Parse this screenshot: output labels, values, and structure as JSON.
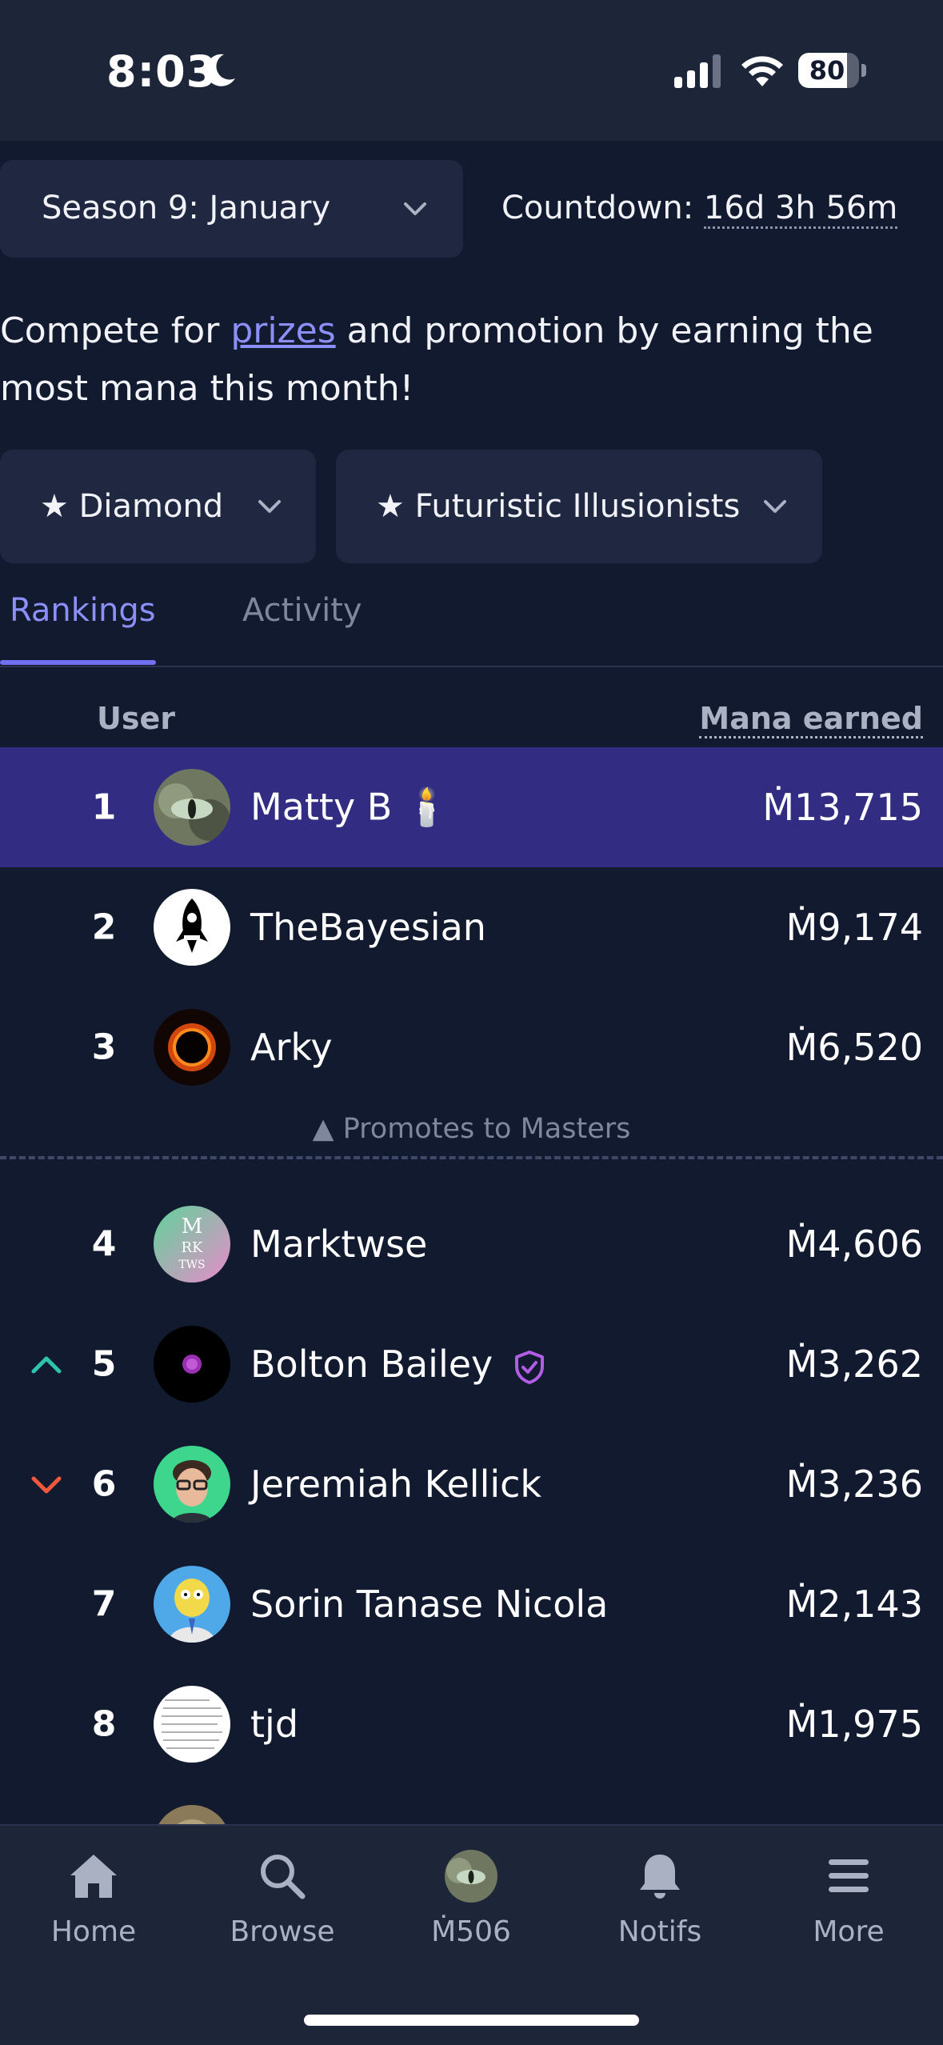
{
  "status_bar": {
    "time": "8:03",
    "battery": "80"
  },
  "season": {
    "label": "Season 9: January"
  },
  "countdown": {
    "prefix": "Countdown: ",
    "value": "16d 3h 56m"
  },
  "intro": {
    "before": "Compete for ",
    "link": "prizes",
    "after": " and promotion by earning the most mana this month!"
  },
  "filters": {
    "division": "★ Diamond",
    "cohort": "★ Futuristic Illusionists"
  },
  "tabs": [
    {
      "label": "Rankings",
      "active": true
    },
    {
      "label": "Activity",
      "active": false
    }
  ],
  "table": {
    "col_user": "User",
    "col_mana": "Mana earned",
    "rows": [
      {
        "rank": "1",
        "name": "Matty B 🕯️",
        "mana": "Ṁ13,715",
        "highlight": true
      },
      {
        "rank": "2",
        "name": "TheBayesian",
        "mana": "Ṁ9,174"
      },
      {
        "rank": "3",
        "name": "Arky",
        "mana": "Ṁ6,520"
      },
      {
        "rank": "4",
        "name": "Marktwse",
        "mana": "Ṁ4,606"
      },
      {
        "rank": "5",
        "name": "Bolton Bailey",
        "mana": "Ṁ3,262",
        "movement": "up",
        "badge": "shield-check-icon"
      },
      {
        "rank": "6",
        "name": "Jeremiah Kellick",
        "mana": "Ṁ3,236",
        "movement": "down"
      },
      {
        "rank": "7",
        "name": "Sorin Tanase Nicola",
        "mana": "Ṁ2,143"
      },
      {
        "rank": "8",
        "name": "tjd",
        "mana": "Ṁ1,975"
      }
    ],
    "promotion_text": "▲ Promotes to Masters"
  },
  "avatar_text": {
    "marktwse": [
      "M",
      "RK",
      "TWS"
    ]
  },
  "nav": [
    {
      "label": "Home",
      "icon": "home-icon"
    },
    {
      "label": "Browse",
      "icon": "search-icon"
    },
    {
      "label": "Ṁ506",
      "icon": "profile-avatar"
    },
    {
      "label": "Notifs",
      "icon": "bell-icon"
    },
    {
      "label": "More",
      "icon": "menu-icon"
    }
  ],
  "colors": {
    "accent": "#8b8ff7",
    "highlight_row": "#322c82",
    "up": "#2dc4b0",
    "down": "#f2593b"
  }
}
